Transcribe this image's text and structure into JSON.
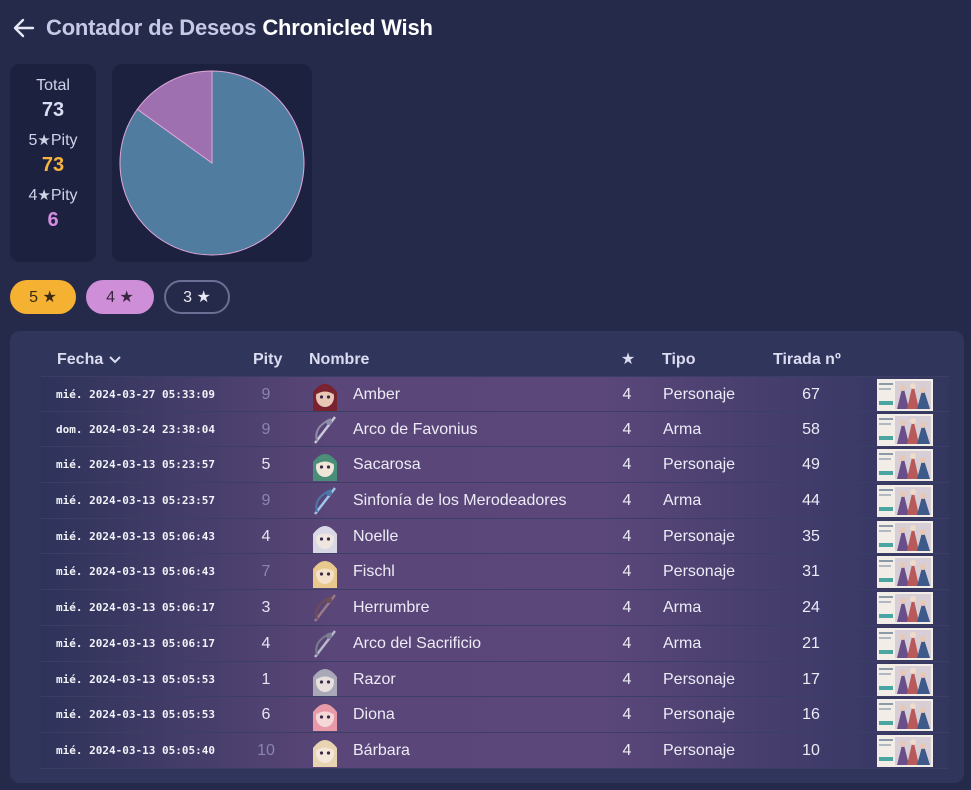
{
  "header": {
    "title": "Contador de Deseos",
    "banner_name": "Chronicled Wish",
    "back_icon": "arrow-left-icon"
  },
  "stats": {
    "total_label": "Total",
    "total_value": "73",
    "five_label_prefix": "5",
    "five_label_suffix": "Pity",
    "five_value": "73",
    "four_label_prefix": "4",
    "four_label_suffix": "Pity",
    "four_value": "6",
    "star_glyph": "★",
    "colors": {
      "five": "#f7b43f",
      "four": "#d48ce0"
    }
  },
  "chart_data": {
    "type": "pie",
    "slices": [
      {
        "label": "3★",
        "value": 62,
        "color": "#507d9f"
      },
      {
        "label": "4★",
        "value": 11,
        "color": "#9e70b0"
      }
    ]
  },
  "filters": [
    {
      "label": "5 ★",
      "color": "#f5b132"
    },
    {
      "label": "4 ★",
      "color": "#cf8fd8"
    },
    {
      "label": "3 ★",
      "color": "transparent"
    }
  ],
  "table": {
    "headers": {
      "date": "Fecha",
      "pity": "Pity",
      "name": "Nombre",
      "rarity": "★",
      "type": "Tipo",
      "pull": "Tirada nº"
    },
    "rows": [
      {
        "date": "mié. 2024-03-27 05:33:09",
        "pity": "9",
        "dim": true,
        "name": "Amber",
        "rarity": "4",
        "type": "Personaje",
        "pull": "67",
        "icon": "amber-avatar-icon"
      },
      {
        "date": "dom. 2024-03-24 23:38:04",
        "pity": "9",
        "dim": true,
        "name": "Arco de Favonius",
        "rarity": "4",
        "type": "Arma",
        "pull": "58",
        "icon": "bow-icon"
      },
      {
        "date": "mié. 2024-03-13 05:23:57",
        "pity": "5",
        "dim": false,
        "name": "Sacarosa",
        "rarity": "4",
        "type": "Personaje",
        "pull": "49",
        "icon": "sucrose-avatar-icon"
      },
      {
        "date": "mié. 2024-03-13 05:23:57",
        "pity": "9",
        "dim": true,
        "name": "Sinfonía de los Merodeadores",
        "rarity": "4",
        "type": "Arma",
        "pull": "44",
        "icon": "catalyst-icon"
      },
      {
        "date": "mié. 2024-03-13 05:06:43",
        "pity": "4",
        "dim": false,
        "name": "Noelle",
        "rarity": "4",
        "type": "Personaje",
        "pull": "35",
        "icon": "noelle-avatar-icon"
      },
      {
        "date": "mié. 2024-03-13 05:06:43",
        "pity": "7",
        "dim": true,
        "name": "Fischl",
        "rarity": "4",
        "type": "Personaje",
        "pull": "31",
        "icon": "fischl-avatar-icon"
      },
      {
        "date": "mié. 2024-03-13 05:06:17",
        "pity": "3",
        "dim": false,
        "name": "Herrumbre",
        "rarity": "4",
        "type": "Arma",
        "pull": "24",
        "icon": "bow-icon"
      },
      {
        "date": "mié. 2024-03-13 05:06:17",
        "pity": "4",
        "dim": false,
        "name": "Arco del Sacrificio",
        "rarity": "4",
        "type": "Arma",
        "pull": "21",
        "icon": "bow-icon"
      },
      {
        "date": "mié. 2024-03-13 05:05:53",
        "pity": "1",
        "dim": false,
        "name": "Razor",
        "rarity": "4",
        "type": "Personaje",
        "pull": "17",
        "icon": "razor-avatar-icon"
      },
      {
        "date": "mié. 2024-03-13 05:05:53",
        "pity": "6",
        "dim": false,
        "name": "Diona",
        "rarity": "4",
        "type": "Personaje",
        "pull": "16",
        "icon": "diona-avatar-icon"
      },
      {
        "date": "mié. 2024-03-13 05:05:40",
        "pity": "10",
        "dim": true,
        "name": "Bárbara",
        "rarity": "4",
        "type": "Personaje",
        "pull": "10",
        "icon": "barbara-avatar-icon"
      }
    ]
  }
}
